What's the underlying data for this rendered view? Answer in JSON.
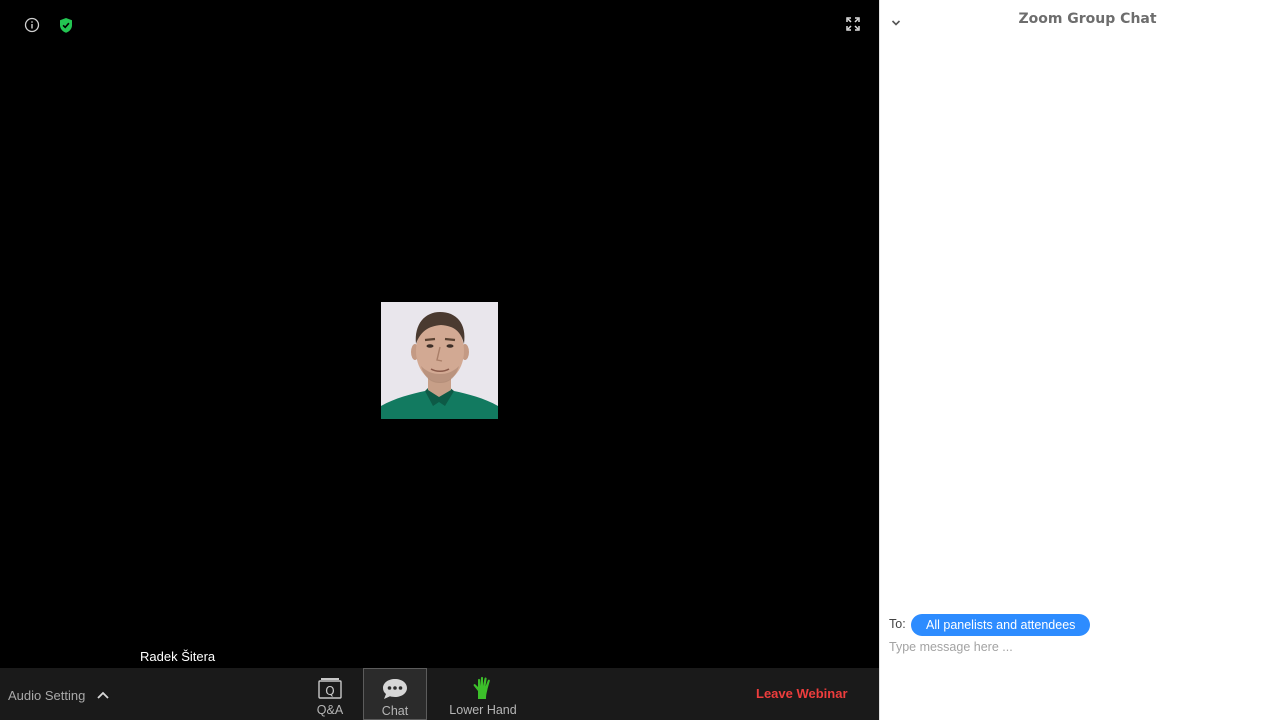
{
  "video": {
    "participant_name": "Radek Šitera"
  },
  "toolbar": {
    "audio_setting_label": "Audio Setting",
    "qa_label": "Q&A",
    "chat_label": "Chat",
    "lower_hand_label": "Lower Hand",
    "leave_label": "Leave Webinar"
  },
  "chat": {
    "title": "Zoom Group Chat",
    "to_label": "To:",
    "recipient": "All panelists and attendees",
    "placeholder": "Type message here ..."
  },
  "colors": {
    "accent": "#2d8cff",
    "leave": "#ee3d3d",
    "shield": "#23c552",
    "hand": "#3cbf2a"
  },
  "icons": [
    "info-icon",
    "shield-icon",
    "fullscreen-icon",
    "chevron-up-icon",
    "qa-icon",
    "chat-bubble-icon",
    "raised-hand-icon",
    "chevron-down-icon"
  ]
}
